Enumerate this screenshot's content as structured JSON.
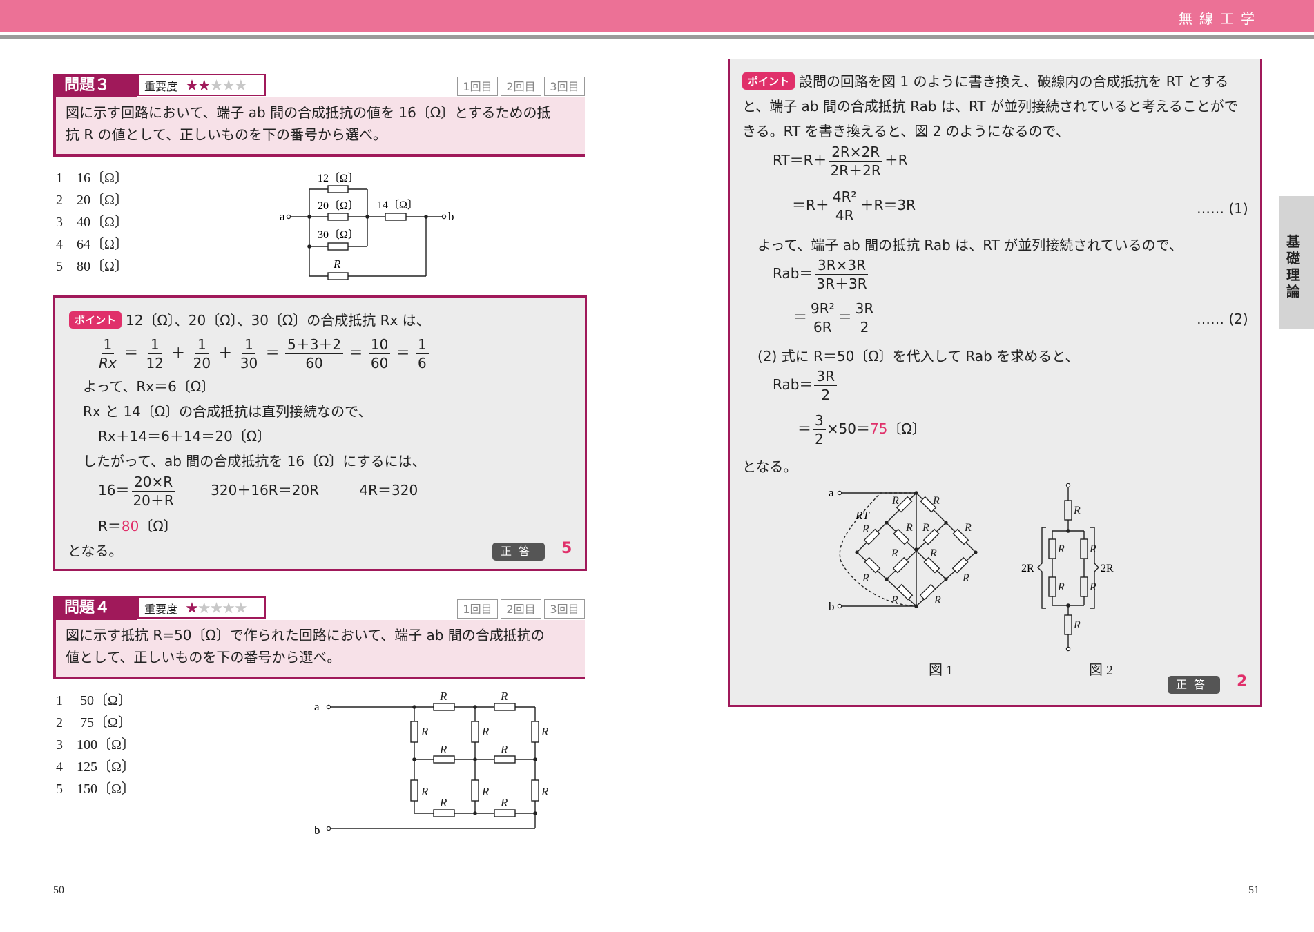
{
  "header": {
    "title": "無線工学"
  },
  "side_tab": {
    "label": "基礎理論"
  },
  "q3": {
    "label": "問題３",
    "importance_label": "重要度",
    "stars_filled": "★★",
    "stars_empty": "★★★",
    "attempts": [
      "1回目",
      "2回目",
      "3回目"
    ],
    "question_line1": "図に示す回路において、端子 ab 間の合成抵抗の値を 16〔Ω〕とするための抵",
    "question_line2": "抗 R の値として、正しいものを下の番号から選べ。",
    "choices": [
      "1　16〔Ω〕",
      "2　20〔Ω〕",
      "3　40〔Ω〕",
      "4　64〔Ω〕",
      "5　80〔Ω〕"
    ],
    "circuit": {
      "r12": "12〔Ω〕",
      "r20": "20〔Ω〕",
      "r30": "30〔Ω〕",
      "r14": "14〔Ω〕",
      "r": "R",
      "a": "a",
      "b": "b"
    }
  },
  "p3": {
    "badge": "ポイント",
    "l1": "12〔Ω〕、20〔Ω〕、30〔Ω〕の合成抵抗 Rx は、",
    "eq1": {
      "one": "1",
      "rx": "Rx",
      "d12": "12",
      "d20": "20",
      "d30": "30",
      "num": "5＋3＋2",
      "den": "60",
      "n10": "10",
      "d60": "60",
      "d6": "6"
    },
    "l3": "よって、Rx＝6〔Ω〕",
    "l4": "Rx と 14〔Ω〕の合成抵抗は直列接続なので、",
    "l5": "Rx＋14＝6＋14＝20〔Ω〕",
    "l6": "したがって、ab 間の合成抵抗を 16〔Ω〕にするには、",
    "eq2": {
      "lhs": "16＝",
      "num": "20×R",
      "den": "20＋R",
      "mid": "320＋16R＝20R",
      "rhs": "4R＝320"
    },
    "l8a": "R＝",
    "l8b": "80",
    "l8c": "〔Ω〕",
    "l9": "となる。",
    "answer_label": "正答",
    "answer": "5"
  },
  "q4": {
    "label": "問題４",
    "importance_label": "重要度",
    "stars_filled": "★",
    "stars_empty": "★★★★",
    "attempts": [
      "1回目",
      "2回目",
      "3回目"
    ],
    "question_line1": "図に示す抵抗 R=50〔Ω〕で作られた回路において、端子 ab 間の合成抵抗の",
    "question_line2": "値として、正しいものを下の番号から選べ。",
    "choices": [
      "1　 50〔Ω〕",
      "2　 75〔Ω〕",
      "3　100〔Ω〕",
      "4　125〔Ω〕",
      "5　150〔Ω〕"
    ],
    "circuit": {
      "r": "R",
      "a": "a",
      "b": "b"
    }
  },
  "p4": {
    "badge": "ポイント",
    "l1": "設問の回路を図 1 のように書き換え、破線内の合成抵抗を RT とする",
    "l2": "と、端子 ab 間の合成抵抗 Rab は、RT が並列接続されていると考えることがで",
    "l3": "きる。RT を書き換えると、図 2 のようになるので、",
    "eq1": {
      "lhs": "RT＝R＋",
      "num": "2R×2R",
      "den": "2R＋2R",
      "rhs": "＋R"
    },
    "eq2": {
      "lhs": "＝R＋",
      "num": "4R²",
      "den": "4R",
      "rhs": "＋R＝3R",
      "tag": "…… (1)"
    },
    "l6": "よって、端子 ab 間の抵抗 Rab は、RT が並列接続されているので、",
    "eq3": {
      "lhs": "Rab＝",
      "num": "3R×3R",
      "den": "3R＋3R"
    },
    "eq4": {
      "lhs": "＝",
      "num1": "9R²",
      "den1": "6R",
      "eq": "＝",
      "num2": "3R",
      "den2": "2",
      "tag": "…… (2)"
    },
    "l9": "(2) 式に R＝50〔Ω〕を代入して Rab を求めると、",
    "eq5": {
      "lhs": "Rab＝",
      "num": "3R",
      "den": "2"
    },
    "eq6": {
      "lhs": "＝",
      "num": "3",
      "den": "2",
      "mid": "×50＝",
      "val": "75",
      "unit": "〔Ω〕"
    },
    "l12": "となる。",
    "fig1_caption": "図 1",
    "fig2_caption": "図 2",
    "fig1": {
      "a": "a",
      "b": "b",
      "rt": "RT",
      "r": "R"
    },
    "fig2": {
      "r": "R",
      "two_r": "2R"
    },
    "answer_label": "正答",
    "answer": "2"
  },
  "page_left": "50",
  "page_right": "51",
  "colors": {
    "accent": "#a0195a",
    "pink": "#e0306a",
    "header": "#ec7196"
  }
}
